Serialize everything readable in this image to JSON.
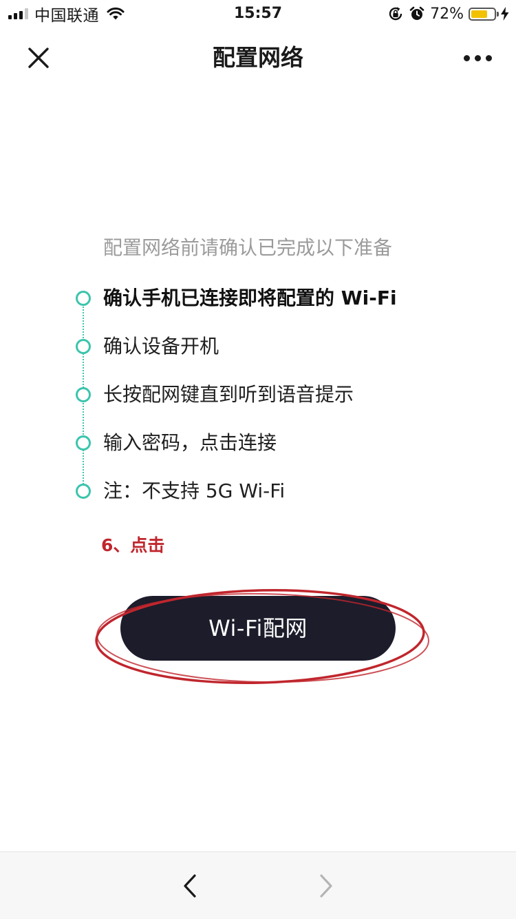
{
  "status_bar": {
    "carrier": "中国联通",
    "time": "15:57",
    "battery_percent": "72%",
    "battery_level": 0.72,
    "icons": [
      "signal-bars-icon",
      "wifi-icon",
      "orientation-lock-icon",
      "alarm-icon",
      "battery-icon",
      "charging-bolt-icon"
    ]
  },
  "nav_bar": {
    "title": "配置网络",
    "left_icon": "close-icon",
    "right_icon": "more-dots-icon"
  },
  "content": {
    "intro": "配置网络前请确认已完成以下准备",
    "steps": [
      {
        "text": "确认手机已连接即将配置的 Wi-Fi",
        "bold": true
      },
      {
        "text": "确认设备开机",
        "bold": false
      },
      {
        "text": "长按配网键直到听到语音提示",
        "bold": false
      },
      {
        "text": "输入密码，点击连接",
        "bold": false
      },
      {
        "text": "注：不支持 5G Wi-Fi",
        "bold": false
      }
    ],
    "annotation": "6、点击",
    "button_label": "Wi-Fi配网"
  },
  "bottom_bar": {
    "back_icon": "chevron-left-icon",
    "forward_icon": "chevron-right-icon"
  },
  "colors": {
    "accent_teal": "#3cc4ad",
    "button_bg": "#1c1c2b",
    "annotation_red": "#c0262d",
    "intro_gray": "#9b9b9b",
    "battery_yellow": "#f2c200"
  }
}
